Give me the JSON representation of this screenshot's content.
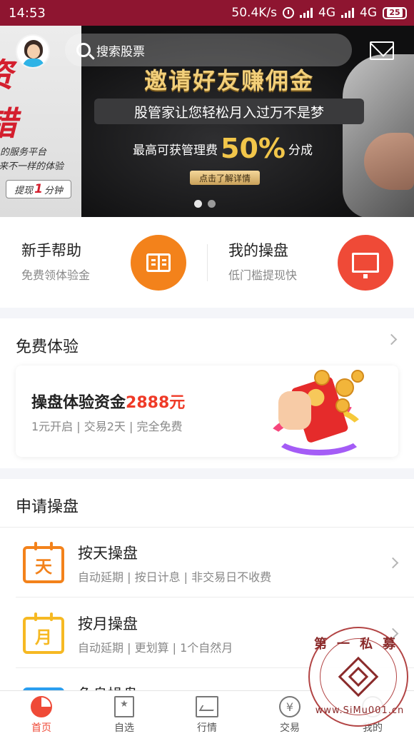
{
  "status": {
    "time": "14:53",
    "speed": "50.4K/s",
    "net1": "4G",
    "net2": "4G",
    "battery": "25"
  },
  "banner": {
    "left_big1": "资",
    "left_big2": "错",
    "left_line1": "的服务平台",
    "left_line2": "来不一样的体验",
    "left_btn_prefix": "提现",
    "left_btn_num": "1",
    "left_btn_suffix": "分钟",
    "title": "邀请好友赚佣金",
    "subtitle": "股管家让您轻松月入过万不是梦",
    "fee_prefix": "最高可获管理费",
    "fee_pct": "50%",
    "fee_suffix": "分成",
    "detail_btn": "点击了解详情"
  },
  "header": {
    "search_placeholder": "搜索股票"
  },
  "quick": [
    {
      "title": "新手帮助",
      "sub": "免费领体验金"
    },
    {
      "title": "我的操盘",
      "sub": "低门槛提现快"
    }
  ],
  "free": {
    "heading": "免费体验",
    "card_title_prefix": "操盘体验资金",
    "card_amount": "2888元",
    "card_sub": "1元开启 | 交易2天 | 完全免费"
  },
  "apply": {
    "heading": "申请操盘",
    "rows": [
      {
        "icon_char": "天",
        "title": "按天操盘",
        "sub": "自动延期 | 按日计息 | 非交易日不收费"
      },
      {
        "icon_char": "月",
        "title": "按月操盘",
        "sub": "自动延期 | 更划算 | 1个自然月"
      },
      {
        "icon_char": "",
        "title": "免息操盘",
        "sub": ""
      }
    ]
  },
  "nav": [
    {
      "label": "首页"
    },
    {
      "label": "自选"
    },
    {
      "label": "行情"
    },
    {
      "label": "交易"
    },
    {
      "label": "我的"
    }
  ],
  "watermark": {
    "top": "第一私募",
    "bottom": "www.SiMu001.cn"
  },
  "colors": {
    "statusbar": "#8e1530",
    "accent": "#ef4a37",
    "orange": "#f3821b"
  }
}
